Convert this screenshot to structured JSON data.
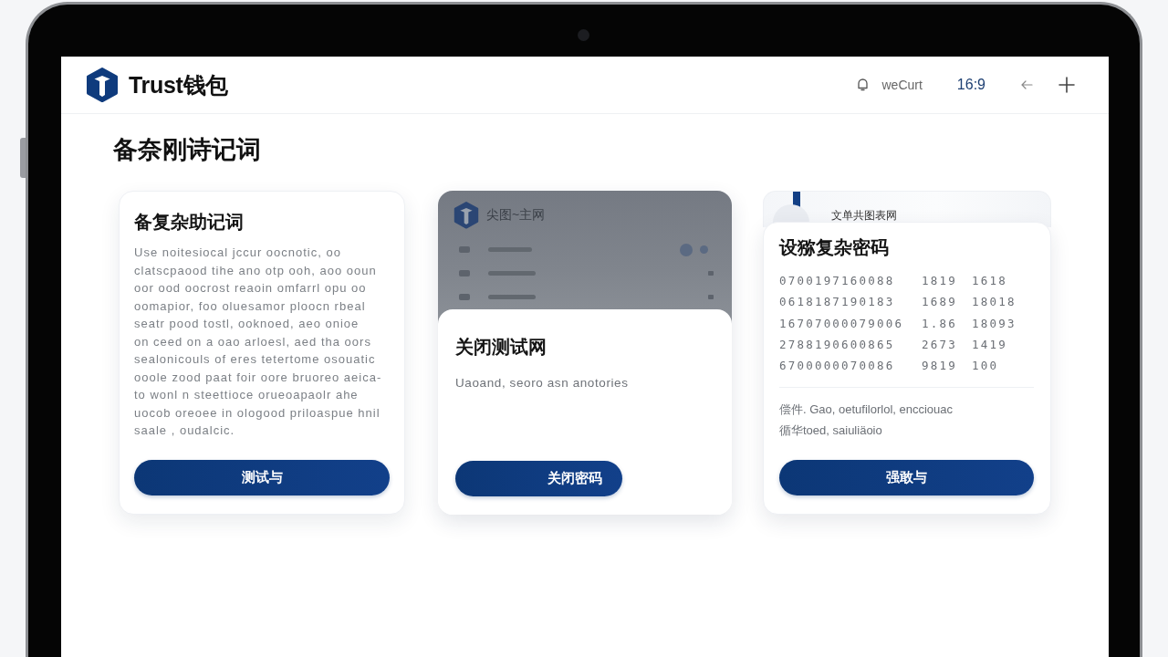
{
  "header": {
    "brand": "Trust钱包",
    "account": "weCurt",
    "ratio": "16:9"
  },
  "page_title": "备奈刚诗记词",
  "cards": [
    {
      "kind": "text",
      "title": "备复杂助记词",
      "body_lines": [
        "Use noitesiocal jccur oocnotic, oo",
        "clatscpaood  tihe ano otp ooh, aoo ooun",
        "oor ood oocrost reaoin omfarrl opu oo",
        "oomapior, foo oluesamor ploocn rbeal",
        "seatr pood tostl, ooknoed, aeo onioe",
        "on ceed on a oao arloesl, aed tha oors",
        "sealonicouls of eres tetertome osouatic",
        "ooole zood paat foir oore bruoreo aeica-",
        "to wonl n steettioce orueoapaolr ahe",
        "uocob oreoee in ologood priloaspue  hnil",
        "saale , oudalcic."
      ],
      "button": "测试与"
    },
    {
      "kind": "sheet",
      "backdrop_title": "尖图~主网",
      "title": "关闭测试网",
      "body": "Uaoand, seoro asn anotories",
      "button": "关闭密码"
    },
    {
      "kind": "stacked",
      "back_title": "文单共图表网",
      "title": "设猕复杂密码",
      "table_rows": [
        [
          "0700197160088",
          "1819",
          "1618"
        ],
        [
          "0618187190183",
          "1689",
          "18018"
        ],
        [
          "16707000079006",
          "1.86",
          "18093"
        ],
        [
          "2788190600865",
          "2673",
          "1419"
        ],
        [
          "6700000070086",
          "9819",
          "100"
        ]
      ],
      "note_lines": [
        "偿件. Gao, oetufilorlol, encciouac",
        "循华toed, saiuliäoio"
      ],
      "button": "强敢与"
    }
  ]
}
